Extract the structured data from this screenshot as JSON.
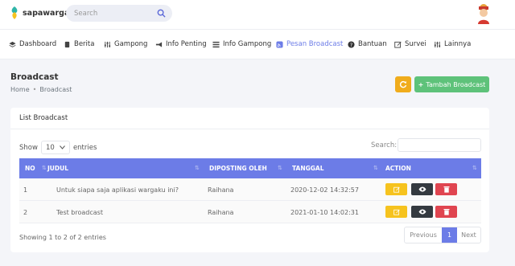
{
  "header": {
    "brand": "sapawarga",
    "search_placeholder": "Search"
  },
  "nav": [
    {
      "label": "Dashboard",
      "icon": "layers-icon",
      "active": false
    },
    {
      "label": "Berita",
      "icon": "book-icon",
      "active": false
    },
    {
      "label": "Gampong",
      "icon": "sliders-icon",
      "active": false
    },
    {
      "label": "Info Penting",
      "icon": "megaphone-icon",
      "active": false
    },
    {
      "label": "Info Gampong",
      "icon": "list-icon",
      "active": false
    },
    {
      "label": "Pesan Broadcast",
      "icon": "rss-icon",
      "active": true
    },
    {
      "label": "Bantuan",
      "icon": "question-circle-icon",
      "active": false
    },
    {
      "label": "Survei",
      "icon": "edit-icon",
      "active": false
    },
    {
      "label": "Lainnya",
      "icon": "sliders-icon",
      "active": false
    }
  ],
  "page": {
    "title": "Broadcast",
    "breadcrumb": [
      "Home",
      "Broadcast"
    ],
    "add_button": "Tambah Broadcast"
  },
  "card": {
    "title": "List Broadcast",
    "show_label": "Show",
    "entries_value": "10",
    "entries_label": "entries",
    "search_label": "Search:"
  },
  "table": {
    "columns": [
      "NO",
      "JUDUL",
      "DIPOSTING OLEH",
      "TANGGAL",
      "ACTION"
    ],
    "rows": [
      {
        "no": "1",
        "judul": "Untuk siapa saja aplikasi wargaku ini?",
        "oleh": "Raihana",
        "tanggal": "2020-12-02 14:32:57"
      },
      {
        "no": "2",
        "judul": "Test broadcast",
        "oleh": "Raihana",
        "tanggal": "2021-01-10 14:02:31"
      }
    ]
  },
  "footer": {
    "info": "Showing 1 to 2 of 2 entries",
    "prev": "Previous",
    "page": "1",
    "next": "Next"
  },
  "colors": {
    "accent": "#6c7ce7",
    "warning": "#f0ac1c",
    "success": "#5ec27a",
    "dark": "#343a40",
    "danger": "#e04550"
  }
}
